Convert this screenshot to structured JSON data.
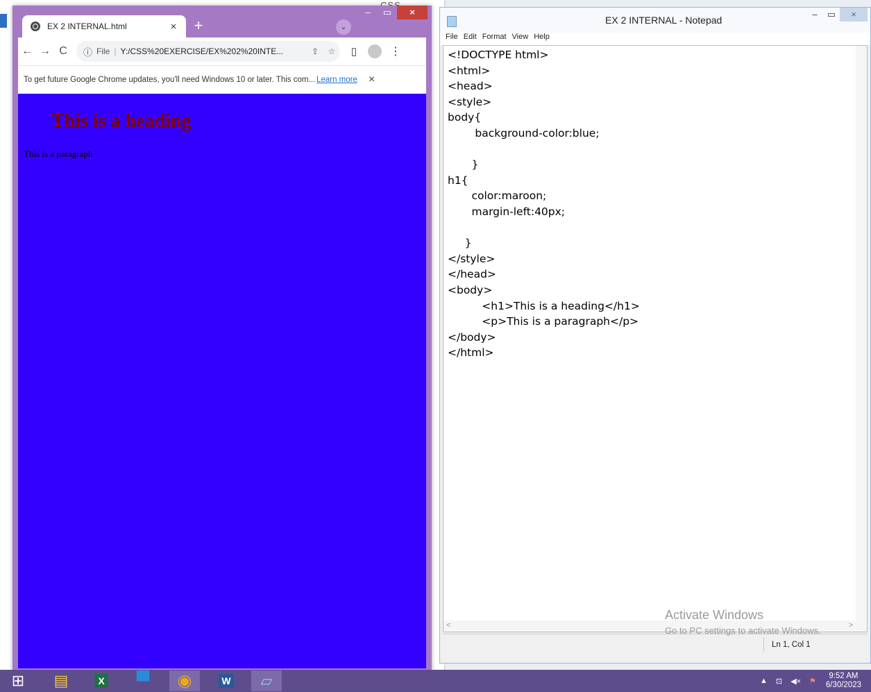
{
  "background_window": {
    "title": "CSS EXERCISE"
  },
  "browser": {
    "tab": {
      "title": "EX 2 INTERNAL.html",
      "close": "×"
    },
    "new_tab": "+",
    "tab_search": "⌄",
    "window_controls": {
      "minimize": "–",
      "maximize": "▭",
      "close": "×"
    },
    "toolbar": {
      "back": "←",
      "forward": "→",
      "reload": "C",
      "info": "ⓘ",
      "scheme": "File",
      "separator": "|",
      "url": "Y:/CSS%20EXERCISE/EX%202%20INTE...",
      "share": "⇪",
      "star": "☆",
      "side_panel": "▯",
      "menu": "⋮"
    },
    "infobar": {
      "message": "To get future Google Chrome updates, you'll need Windows 10 or later. This com...",
      "link": "Learn more",
      "close": "×"
    },
    "page": {
      "heading": "This is a heading",
      "paragraph": "This is a paragraph"
    }
  },
  "notepad": {
    "title": "EX 2 INTERNAL - Notepad",
    "window_controls": {
      "minimize": "–",
      "maximize": "▭",
      "close": "×"
    },
    "menu": [
      "File",
      "Edit",
      "Format",
      "View",
      "Help"
    ],
    "code": "<!DOCTYPE html>\n<html>\n<head>\n<style>\nbody{\n        background-color:blue;\n\n       }\nh1{\n       color:maroon;\n       margin-left:40px;\n\n     }\n</style>\n</head>\n<body>\n          <h1>This is a heading</h1>\n          <p>This is a paragraph</p>\n</body>\n</html>",
    "status": "Ln 1, Col 1",
    "scroll_left": "<",
    "scroll_right": ">"
  },
  "watermark": {
    "line1": "Activate Windows",
    "line2": "Go to PC settings to activate Windows."
  },
  "taskbar": {
    "apps": [
      {
        "name": "start",
        "glyph": "⊞",
        "color": "#ffffff"
      },
      {
        "name": "file-explorer",
        "glyph": "▤",
        "color": "#f4c84c"
      },
      {
        "name": "excel",
        "glyph": "X",
        "color": "#1e7145"
      },
      {
        "name": "store",
        "glyph": "▀",
        "color": "#2a8cd8"
      },
      {
        "name": "chrome",
        "glyph": "◉",
        "color": "#e8a91a"
      },
      {
        "name": "word",
        "glyph": "W",
        "color": "#2b579a"
      },
      {
        "name": "notepad",
        "glyph": "▱",
        "color": "#9cc8ea"
      }
    ],
    "tray": {
      "caret": "▲",
      "network": "⊡",
      "volume": "◀×",
      "flag": "⚑",
      "time": "9:52 AM",
      "date": "6/30/2023"
    }
  }
}
